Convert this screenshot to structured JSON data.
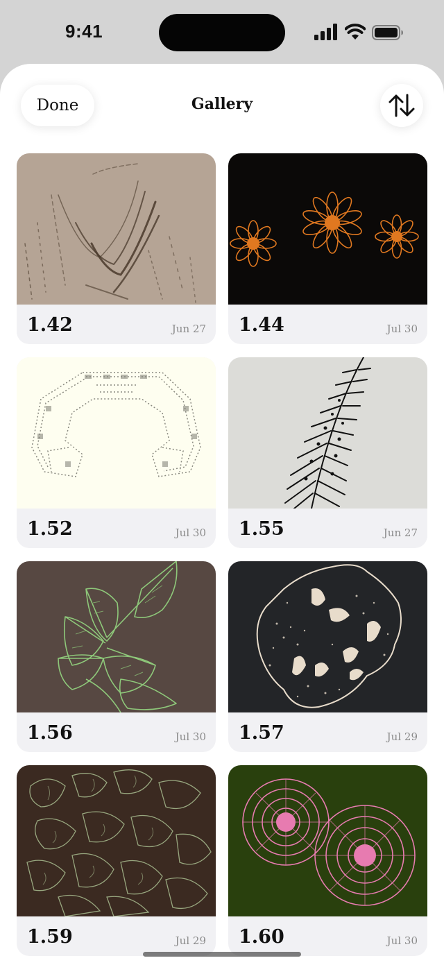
{
  "status_bar": {
    "time": "9:41"
  },
  "header": {
    "done_label": "Done",
    "title": "Gallery",
    "sort_icon": "arrow-up-down-icon"
  },
  "gallery": {
    "items": [
      {
        "version": "1.42",
        "date": "Jun 27",
        "art": "wood-grain",
        "bg": "#b5a495"
      },
      {
        "version": "1.44",
        "date": "Jul 30",
        "art": "orange-flowers",
        "bg": "#0b0908"
      },
      {
        "version": "1.52",
        "date": "Jul 30",
        "art": "fractal",
        "bg": "#fefef0"
      },
      {
        "version": "1.55",
        "date": "Jun 27",
        "art": "fern",
        "bg": "#dcdcd8"
      },
      {
        "version": "1.56",
        "date": "Jul 30",
        "art": "green-leaves",
        "bg": "#574842"
      },
      {
        "version": "1.57",
        "date": "Jul 29",
        "art": "spotted-rock",
        "bg": "#232528"
      },
      {
        "version": "1.59",
        "date": "Jul 29",
        "art": "succulent-outlines",
        "bg": "#3b2a21"
      },
      {
        "version": "1.60",
        "date": "Jul 30",
        "art": "pink-pinecones",
        "bg": "#29400d"
      }
    ]
  }
}
